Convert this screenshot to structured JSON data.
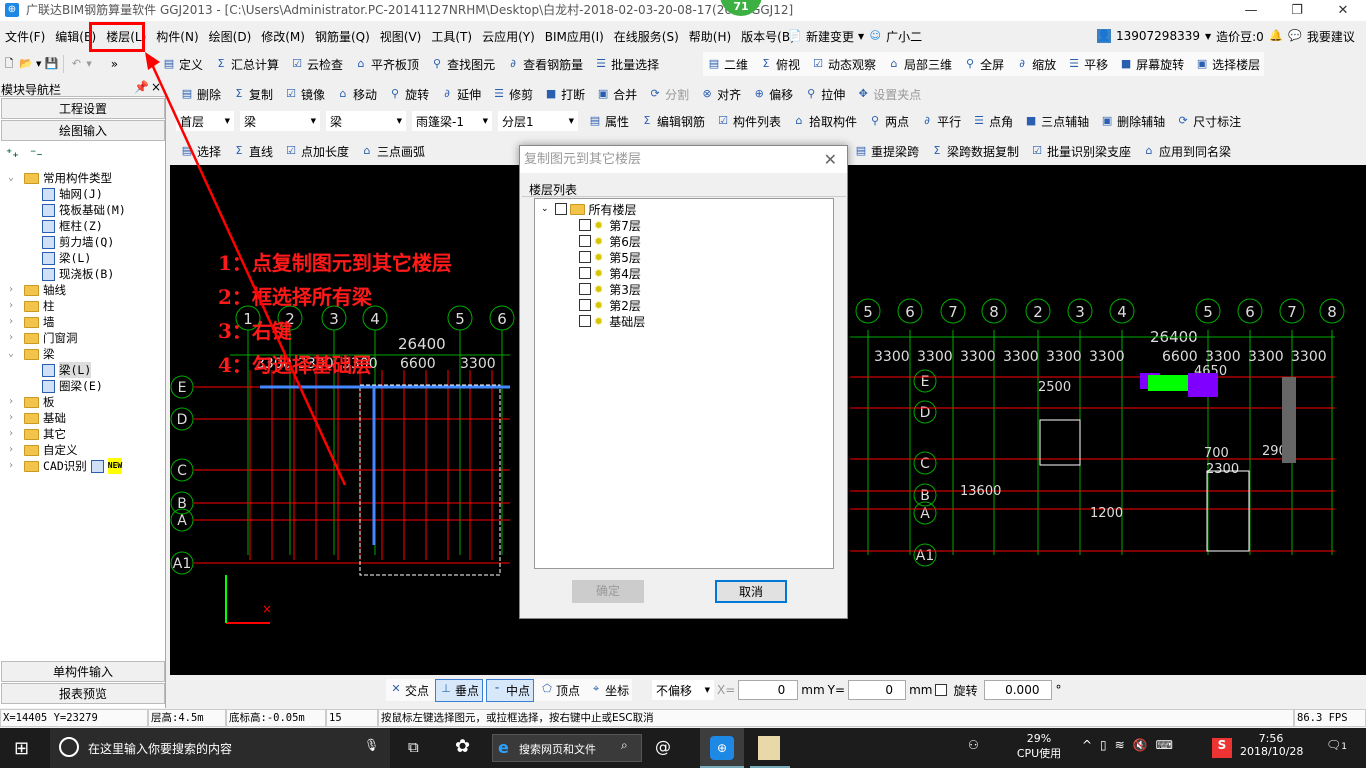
{
  "window": {
    "title": "广联达BIM钢筋算量软件 GGJ2013 - [C:\\Users\\Administrator.PC-20141127NRHM\\Desktop\\白龙村-2018-02-03-20-08-17(260...GGJ12]",
    "badge": "71",
    "minimize": "—",
    "restore": "❐",
    "close": "✕"
  },
  "menu": [
    "文件(F)",
    "编辑(E)",
    "楼层(L)",
    "构件(N)",
    "绘图(D)",
    "修改(M)",
    "钢筋量(Q)",
    "视图(V)",
    "工具(T)",
    "云应用(Y)",
    "BIM应用(I)",
    "在线服务(S)",
    "帮助(H)",
    "版本号(B)"
  ],
  "menu_extra": {
    "new_change": "新建变更",
    "assistant": "广小二",
    "account": "13907298339",
    "beans": "造价豆:0",
    "suggest": "我要建议"
  },
  "toolbar1": [
    "定义",
    "汇总计算",
    "云检查",
    "平齐板顶",
    "查找图元",
    "查看钢筋量",
    "批量选择"
  ],
  "toolbar1_right": [
    "二维",
    "俯视",
    "动态观察",
    "局部三维",
    "全屏",
    "缩放",
    "平移",
    "屏幕旋转",
    "选择楼层"
  ],
  "toolbar2": [
    "删除",
    "复制",
    "镜像",
    "移动",
    "旋转",
    "延伸",
    "修剪",
    "打断",
    "合并",
    "分割",
    "对齐",
    "偏移",
    "拉伸",
    "设置夹点"
  ],
  "toolbar3_selects": [
    "首层",
    "梁",
    "梁",
    "雨篷梁-1",
    "分层1"
  ],
  "toolbar3": [
    "属性",
    "编辑钢筋",
    "构件列表",
    "拾取构件",
    "两点",
    "平行",
    "点角",
    "三点辅轴",
    "删除辅轴",
    "尺寸标注"
  ],
  "toolbar4": [
    "选择",
    "直线",
    "点加长度",
    "三点画弧"
  ],
  "toolbar4_right": [
    "重提梁跨",
    "梁跨数据复制",
    "批量识别梁支座",
    "应用到同名梁"
  ],
  "nav": {
    "title": "模块导航栏",
    "project_settings": "工程设置",
    "drawing_input": "绘图输入",
    "single_input": "单构件输入",
    "report_preview": "报表预览"
  },
  "tree": [
    {
      "label": "常用构件类型",
      "level": 0,
      "expanded": true,
      "folder": true
    },
    {
      "label": "轴网(J)",
      "level": 1
    },
    {
      "label": "筏板基础(M)",
      "level": 1
    },
    {
      "label": "框柱(Z)",
      "level": 1
    },
    {
      "label": "剪力墙(Q)",
      "level": 1
    },
    {
      "label": "梁(L)",
      "level": 1
    },
    {
      "label": "现浇板(B)",
      "level": 1
    },
    {
      "label": "轴线",
      "level": 0,
      "folder": true
    },
    {
      "label": "柱",
      "level": 0,
      "folder": true
    },
    {
      "label": "墙",
      "level": 0,
      "folder": true
    },
    {
      "label": "门窗洞",
      "level": 0,
      "folder": true
    },
    {
      "label": "梁",
      "level": 0,
      "expanded": true,
      "folder": true
    },
    {
      "label": "梁(L)",
      "level": 1,
      "selected": true
    },
    {
      "label": "圈梁(E)",
      "level": 1
    },
    {
      "label": "板",
      "level": 0,
      "folder": true
    },
    {
      "label": "基础",
      "level": 0,
      "folder": true
    },
    {
      "label": "其它",
      "level": 0,
      "folder": true
    },
    {
      "label": "自定义",
      "level": 0,
      "folder": true
    },
    {
      "label": "CAD识别",
      "level": 0,
      "folder": true,
      "badge": "NEW"
    }
  ],
  "annotations": [
    "1：点复制图元到其它楼层",
    "2：框选择所有梁",
    "3：右键",
    "4：勾选择基础层"
  ],
  "cad": {
    "axes_left": [
      "1",
      "2",
      "3",
      "4",
      "5",
      "6"
    ],
    "axes_right": [
      "5",
      "6",
      "7",
      "8",
      "2",
      "3",
      "4",
      "5",
      "6",
      "7",
      "8"
    ],
    "rows_left": [
      "E",
      "D",
      "C",
      "B",
      "A",
      "A1"
    ],
    "rows_right": [
      "E",
      "D",
      "C",
      "B",
      "A",
      "A1"
    ],
    "dim_total": "26400",
    "dim_left": [
      "3300",
      "3300",
      "3300",
      "6600",
      "3300"
    ],
    "dim_right": [
      "3300",
      "3300",
      "3300",
      "3300",
      "3300",
      "3300",
      "6600",
      "3300",
      "3300",
      "3300"
    ],
    "dim_misc": [
      "2500",
      "4650",
      "700",
      "290",
      "2300",
      "13600",
      "1200"
    ]
  },
  "dialog": {
    "title": "复制图元到其它楼层",
    "group": "楼层列表",
    "root": "所有楼层",
    "floors": [
      "第7层",
      "第6层",
      "第5层",
      "第4层",
      "第3层",
      "第2层",
      "基础层"
    ],
    "ok": "确定",
    "cancel": "取消"
  },
  "snap": {
    "items": [
      "交点",
      "垂点",
      "中点",
      "顶点",
      "坐标"
    ],
    "active": [
      "垂点",
      "中点"
    ],
    "offset": "不偏移",
    "x_label": "X=",
    "x": "0",
    "y_label": "Y=",
    "y": "0",
    "unit": "mm",
    "rotate": "旋转",
    "rotate_val": "0.000",
    "deg": "°"
  },
  "status": {
    "coords": "X=14405 Y=23279",
    "floor_height": "层高:4.5m",
    "base_height": "底标高:-0.05m",
    "num": "15",
    "hint": "按鼠标左键选择图元，或拉框选择，按右键中止或ESC取消",
    "fps": "86.3 FPS"
  },
  "taskbar": {
    "search": "在这里输入你要搜索的内容",
    "browser_search": "搜索网页和文件",
    "cpu": "29%",
    "cpu_label": "CPU使用",
    "time": "7:56",
    "date": "2018/10/28",
    "notif": "1"
  },
  "colors": {
    "highlight": "#ff0000",
    "canvas": "#000000",
    "axis": "#00a000"
  }
}
